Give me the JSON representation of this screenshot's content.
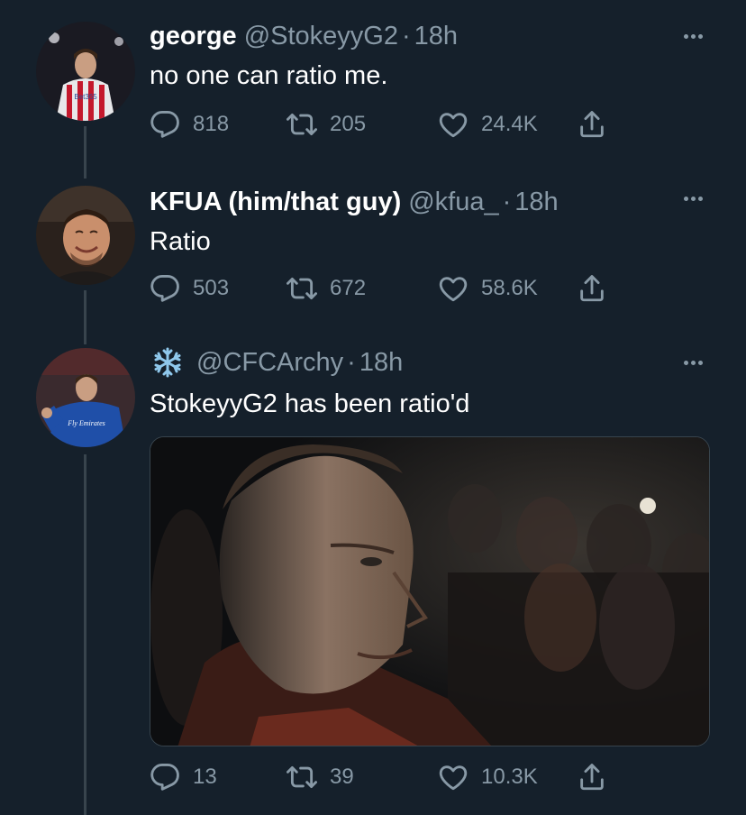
{
  "tweets": [
    {
      "name": "george",
      "handle": "@StokeyyG2",
      "sep": "·",
      "time": "18h",
      "text": "no one can ratio me.",
      "replies": "818",
      "retweets": "205",
      "likes": "24.4K",
      "avatar_jersey_text": "Bet365"
    },
    {
      "name": "KFUA (him/that guy)",
      "handle": "@kfua_",
      "sep": "·",
      "time": "18h",
      "text": "Ratio",
      "replies": "503",
      "retweets": "672",
      "likes": "58.6K"
    },
    {
      "name_icon": "snowflake-icon",
      "handle": "@CFCArchy",
      "sep": "·",
      "time": "18h",
      "text": "StokeyyG2 has been ratio'd",
      "replies": "13",
      "retweets": "39",
      "likes": "10.3K",
      "avatar_jersey_text": "Fly Emirates"
    }
  ],
  "colors": {
    "background": "#15202b",
    "secondary_text": "#8899a6",
    "connector": "#38444d"
  }
}
